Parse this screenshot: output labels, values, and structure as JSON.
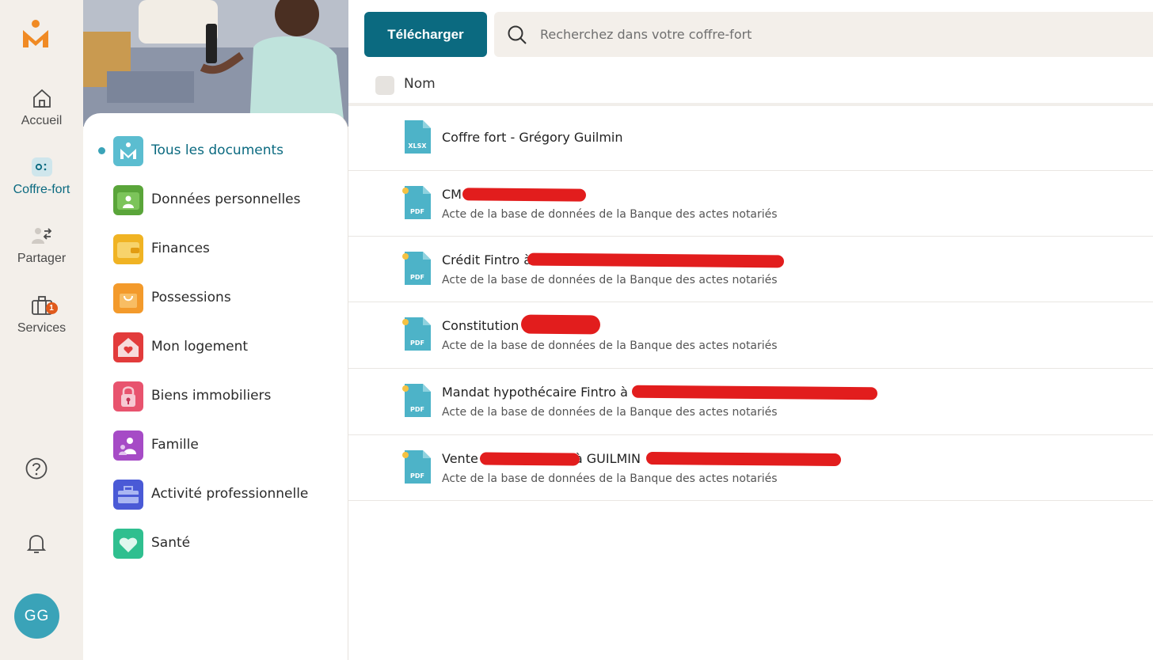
{
  "rail": {
    "items": [
      {
        "label": "Accueil",
        "icon": "home-icon"
      },
      {
        "label": "Coffre-fort",
        "icon": "vault-icon"
      },
      {
        "label": "Partager",
        "icon": "share-users-icon"
      },
      {
        "label": "Services",
        "icon": "briefcase-icon",
        "badge": "1"
      }
    ],
    "avatar": "GG"
  },
  "categories": [
    {
      "label": "Tous les documents",
      "color": "#3aa3b8"
    },
    {
      "label": "Données personnelles",
      "color": "#5aa53a"
    },
    {
      "label": "Finances",
      "color": "#f0b323"
    },
    {
      "label": "Possessions",
      "color": "#f39a2b"
    },
    {
      "label": "Mon logement",
      "color": "#e23b3b"
    },
    {
      "label": "Biens immobiliers",
      "color": "#e8536e"
    },
    {
      "label": "Famille",
      "color": "#a64bc6"
    },
    {
      "label": "Activité professionnelle",
      "color": "#4a5ad6"
    },
    {
      "label": "Santé",
      "color": "#2fbf8f"
    }
  ],
  "toolbar": {
    "upload_label": "Télécharger",
    "search_placeholder": "Recherchez dans votre coffre-fort"
  },
  "table": {
    "column_name": "Nom",
    "rows": [
      {
        "title": "Coffre fort - Grégory Guilmin",
        "subtitle": "",
        "type": "XLSX"
      },
      {
        "title": "CM",
        "subtitle": "Acte de la base de données de la Banque des actes notariés",
        "type": "PDF"
      },
      {
        "title": "Crédit Fintro à",
        "subtitle": "Acte de la base de données de la Banque des actes notariés",
        "type": "PDF"
      },
      {
        "title": "Constitution",
        "subtitle": "Acte de la base de données de la Banque des actes notariés",
        "type": "PDF"
      },
      {
        "title": "Mandat hypothécaire Fintro à",
        "subtitle": "Acte de la base de données de la Banque des actes notariés",
        "type": "PDF"
      },
      {
        "title": "Vente                        à GUILMIN",
        "subtitle": "Acte de la base de données de la Banque des actes notariés",
        "type": "PDF"
      }
    ]
  },
  "colors": {
    "accent": "#0b6a80",
    "file_icon": "#4db3c8",
    "redaction": "#e21d1d"
  }
}
